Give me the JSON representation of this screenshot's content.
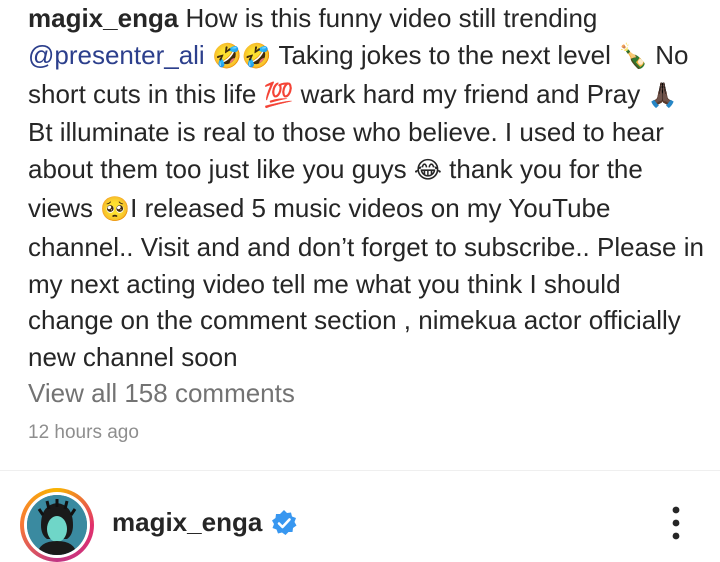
{
  "caption": {
    "username": "magix_enga",
    "text_1": " How is this funny video still trending ",
    "mention": "@presenter_ali",
    "emoji_rofl": "🤣🤣",
    "text_2": " Taking jokes to the next level ",
    "emoji_bottle": "🍾",
    "text_3": " No short cuts in this life ",
    "emoji_100": "💯",
    "text_4": " wark hard my friend and Pray ",
    "emoji_pray": "🙏🏿",
    "text_5": " Bt illuminate is real to those who believe. I used to hear about them too just like you guys ",
    "emoji_joy": "😂",
    "text_6": " thank you for the views ",
    "emoji_pleading": "🥺",
    "text_7": "I released 5 music videos on my YouTube channel.. Visit and and don’t forget to subscribe.. Please in my next acting video tell me what you think I should change on the comment section , nimekua actor officially new channel soon"
  },
  "comments": {
    "view_all_label": "View all 158 comments"
  },
  "timestamp": "12 hours ago",
  "post_header": {
    "username": "magix_enga",
    "verified_icon": "verified-badge-icon",
    "more_icon": "more-options-icon"
  },
  "colors": {
    "mention": "#2c3f8c",
    "verified": "#3897f0",
    "muted": "#737373"
  }
}
